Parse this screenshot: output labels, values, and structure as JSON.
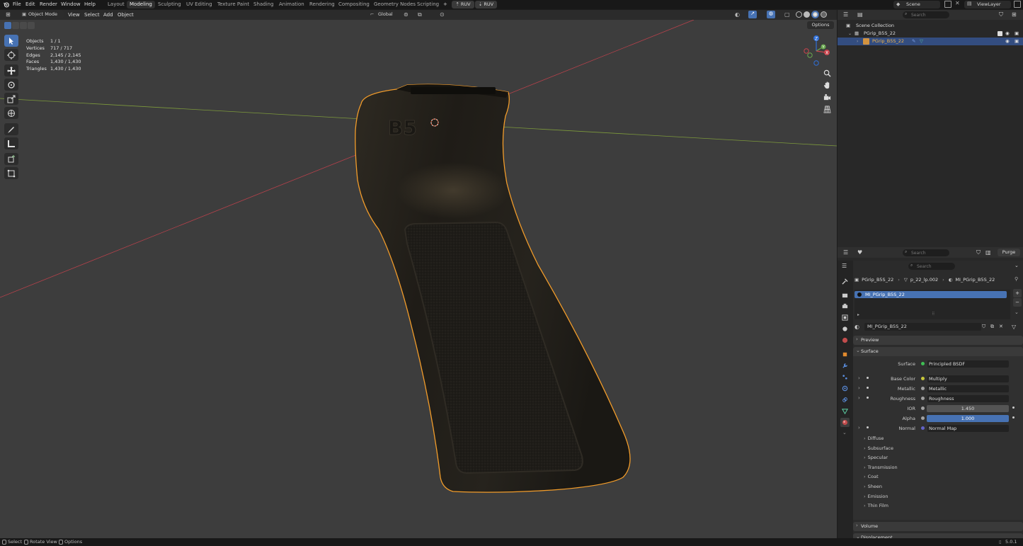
{
  "topbar": {
    "menus": [
      "File",
      "Edit",
      "Render",
      "Window",
      "Help"
    ],
    "workspaces": [
      "Layout",
      "Modeling",
      "Sculpting",
      "UV Editing",
      "Texture Paint",
      "Shading",
      "Animation",
      "Rendering",
      "Compositing",
      "Geometry Nodes",
      "Scripting"
    ],
    "active_workspace": "Modeling",
    "plus": "+",
    "ruv1": "RUV",
    "ruv2": "RUV",
    "scene": "Scene",
    "view_layer": "ViewLayer"
  },
  "viewport": {
    "mode": "Object Mode",
    "menus": [
      "View",
      "Select",
      "Add",
      "Object"
    ],
    "orientation": "Global",
    "options": "Options",
    "stats": [
      {
        "label": "Objects",
        "value": "1 / 1"
      },
      {
        "label": "Vertices",
        "value": "717 / 717"
      },
      {
        "label": "Edges",
        "value": "2,145 / 2,145"
      },
      {
        "label": "Faces",
        "value": "1,430 / 1,430"
      },
      {
        "label": "Triangles",
        "value": "1,430 / 1,430"
      }
    ],
    "gizmo": {
      "z": "Z",
      "y": "Y",
      "x": "X"
    },
    "logo_text": "B5",
    "colors": {
      "background": "#3d3d3d",
      "selection": "#f29c2a",
      "x_axis": "#b7414b",
      "y_axis": "#7d9a3c"
    }
  },
  "outliner": {
    "search_placeholder": "Search",
    "scene_collection": "Scene Collection",
    "items": [
      {
        "name": "PGrip_B5S_22"
      },
      {
        "name": "PGrip_B5S_22"
      }
    ]
  },
  "properties_header": {
    "search_placeholder": "Search",
    "purge": "Purge"
  },
  "properties": {
    "search_placeholder": "Search",
    "breadcrumb": [
      "PGrip_B5S_22",
      "p_22_lp.002",
      "MI_PGrip_B5S_22"
    ],
    "slot": "MI_PGrip_B5S_22",
    "material": "MI_PGrip_B5S_22",
    "panels": {
      "preview": "Preview",
      "surface": "Surface"
    },
    "surface": {
      "label": "Surface",
      "value": "Principled BSDF",
      "rows": [
        {
          "label": "Base Color",
          "value": "Multiply",
          "dot": "#c7c73a"
        },
        {
          "label": "Metallic",
          "value": "Metallic",
          "dot": "#a1a1a1"
        },
        {
          "label": "Roughness",
          "value": "Roughness",
          "dot": "#a1a1a1"
        }
      ],
      "ior_label": "IOR",
      "ior": "1.450",
      "alpha_label": "Alpha",
      "alpha": "1.000",
      "normal_label": "Normal",
      "normal": "Normal Map"
    },
    "subpanels": [
      "Diffuse",
      "Subsurface",
      "Specular",
      "Transmission",
      "Coat",
      "Sheen",
      "Emission",
      "Thin Film"
    ],
    "volume": "Volume",
    "displacement": "Displacement"
  },
  "status": {
    "select": "Select",
    "rotate": "Rotate View",
    "options": "Options",
    "version": "5.0.1"
  }
}
